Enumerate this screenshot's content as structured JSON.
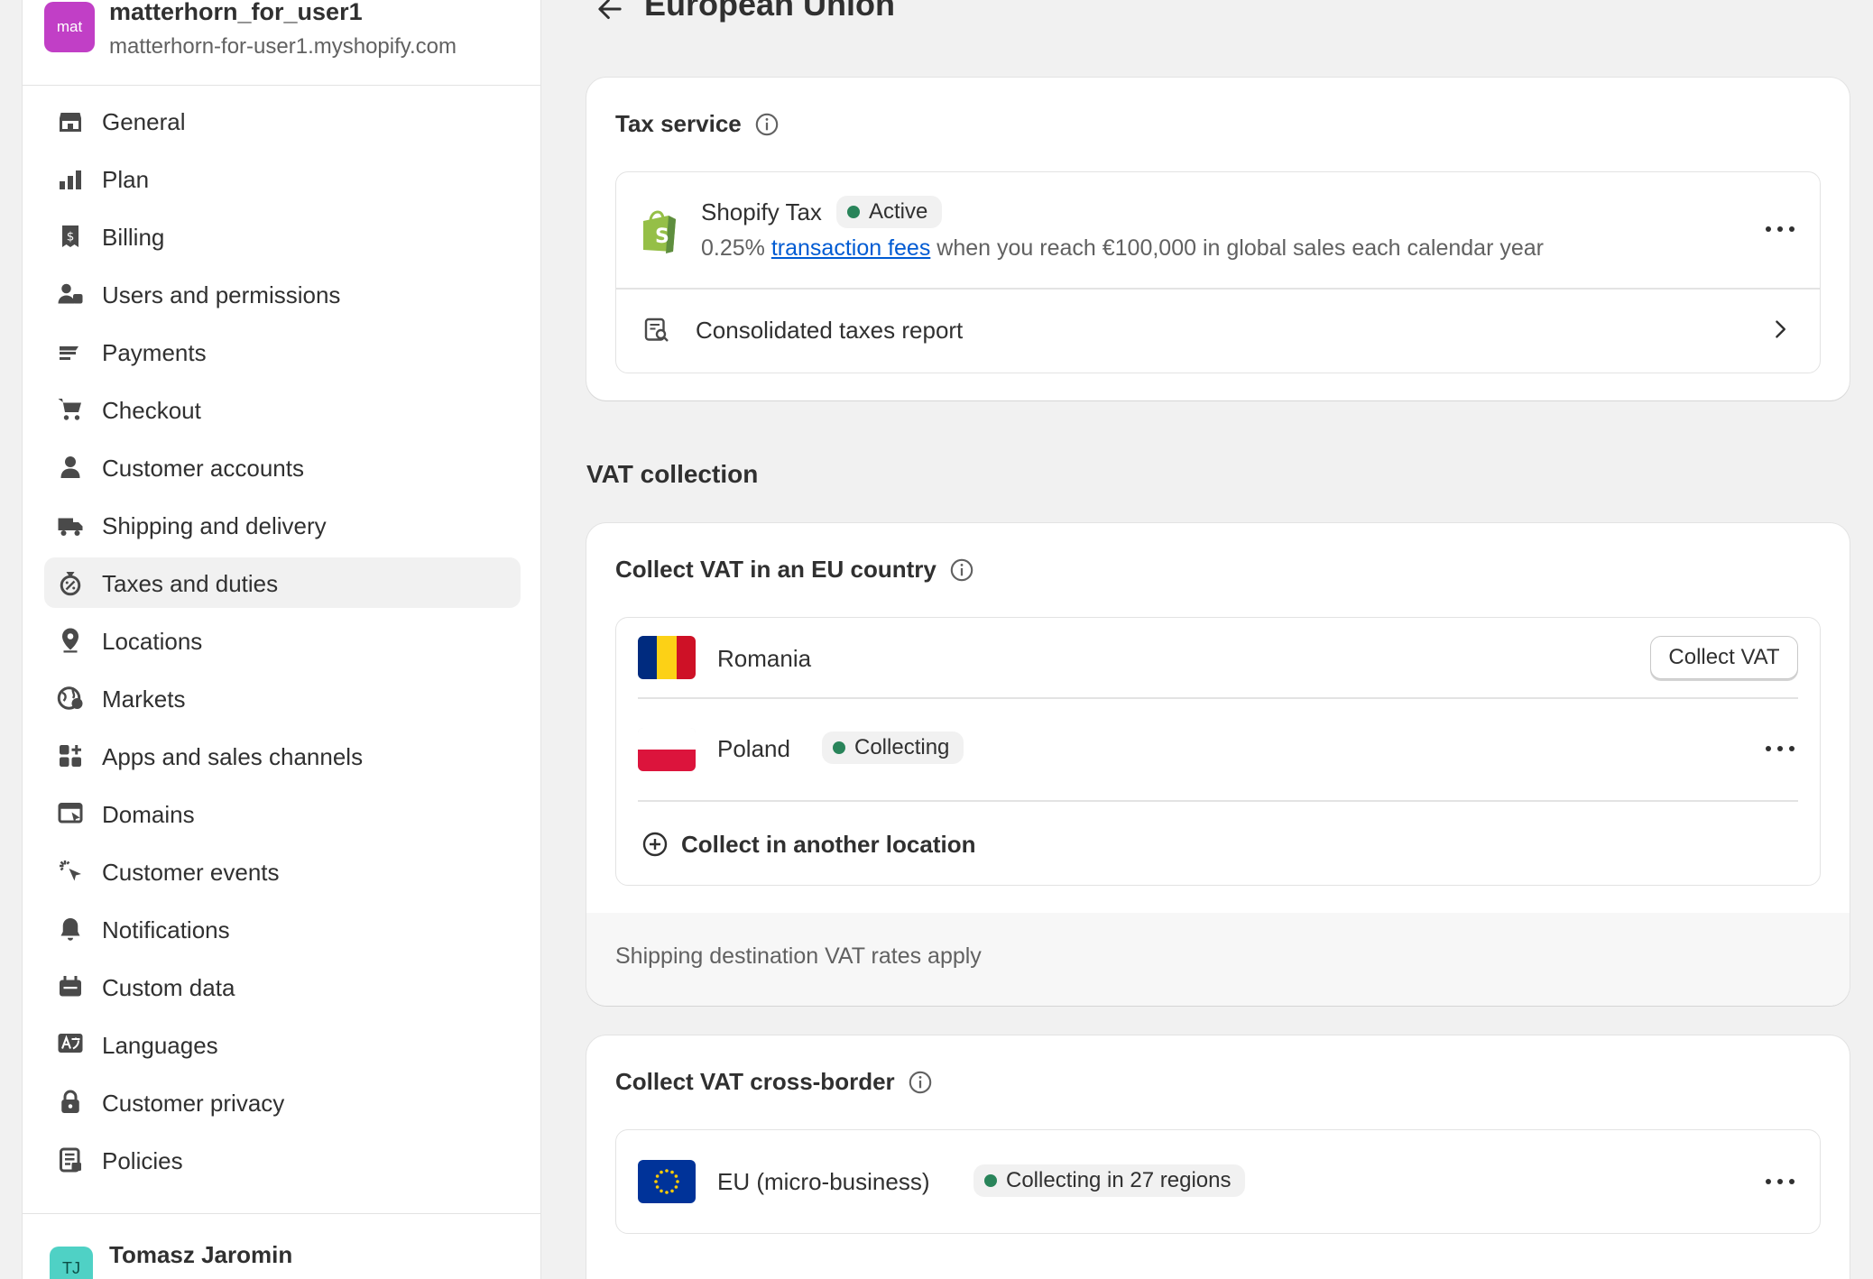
{
  "store": {
    "avatar_text": "mat",
    "name": "matterhorn_for_user1",
    "domain": "matterhorn-for-user1.myshopify.com"
  },
  "nav": {
    "items": [
      {
        "label": "General",
        "icon": "store-icon"
      },
      {
        "label": "Plan",
        "icon": "plan-icon"
      },
      {
        "label": "Billing",
        "icon": "billing-icon"
      },
      {
        "label": "Users and permissions",
        "icon": "users-icon"
      },
      {
        "label": "Payments",
        "icon": "payments-icon"
      },
      {
        "label": "Checkout",
        "icon": "cart-icon"
      },
      {
        "label": "Customer accounts",
        "icon": "person-icon"
      },
      {
        "label": "Shipping and delivery",
        "icon": "truck-icon"
      },
      {
        "label": "Taxes and duties",
        "icon": "taxes-icon",
        "active": true
      },
      {
        "label": "Locations",
        "icon": "location-icon"
      },
      {
        "label": "Markets",
        "icon": "globe-icon"
      },
      {
        "label": "Apps and sales channels",
        "icon": "apps-icon"
      },
      {
        "label": "Domains",
        "icon": "domains-icon"
      },
      {
        "label": "Customer events",
        "icon": "cursor-icon"
      },
      {
        "label": "Notifications",
        "icon": "bell-icon"
      },
      {
        "label": "Custom data",
        "icon": "custom-data-icon"
      },
      {
        "label": "Languages",
        "icon": "language-icon"
      },
      {
        "label": "Customer privacy",
        "icon": "lock-icon"
      },
      {
        "label": "Policies",
        "icon": "policies-icon"
      }
    ]
  },
  "user": {
    "initials": "TJ",
    "name": "Tomasz Jaromin"
  },
  "page": {
    "title": "European Union"
  },
  "tax_service": {
    "title": "Tax service",
    "provider_name": "Shopify Tax",
    "status": "Active",
    "desc_prefix": "0.25%",
    "desc_link": "transaction fees",
    "desc_suffix": "when you reach €100,000 in global sales each calendar year",
    "report_label": "Consolidated taxes report"
  },
  "vat_section": {
    "title": "VAT collection"
  },
  "collect_eu": {
    "title": "Collect VAT in an EU country",
    "countries": [
      {
        "name": "Romania",
        "action": "Collect VAT"
      },
      {
        "name": "Poland",
        "status": "Collecting"
      }
    ],
    "add_label": "Collect in another location",
    "footer_note": "Shipping destination VAT rates apply"
  },
  "cross_border": {
    "title": "Collect VAT cross-border",
    "region_name": "EU (micro-business)",
    "status": "Collecting in 27 regions"
  },
  "colors": {
    "accent_link": "#005bd3",
    "status_dot": "#29845a",
    "store_avatar": "#c13fc6",
    "user_avatar": "#4fd1c5"
  }
}
